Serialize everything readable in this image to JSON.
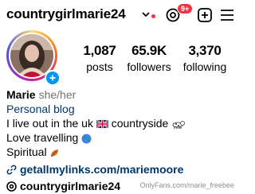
{
  "header": {
    "username": "countrygirlmarie24",
    "notification_count": "9+"
  },
  "stats": [
    {
      "value": "1,087",
      "label": "posts"
    },
    {
      "value": "65.9K",
      "label": "followers"
    },
    {
      "value": "3,370",
      "label": "following"
    }
  ],
  "bio": {
    "name": "Marie",
    "pronouns": "she/her",
    "category": "Personal blog",
    "line1": "I live out in the uk",
    "line1_suffix": "countryside",
    "line2": "Love travelling",
    "line3": "Spiritual",
    "link": "getallmylinks.com/mariemoore"
  },
  "threads_username": "countrygirlmarie24",
  "watermark": "OnlyFans.com/marie_freebee",
  "colors": {
    "accent_blue": "#0095f6",
    "link_blue": "#00376b",
    "notification_red": "#ff3040"
  },
  "icons": [
    "chevron-down-icon",
    "threads-icon",
    "add-icon",
    "menu-icon",
    "link-icon",
    "uk-flag-icon",
    "dog-icon",
    "globe-icon",
    "leaf-icon"
  ]
}
